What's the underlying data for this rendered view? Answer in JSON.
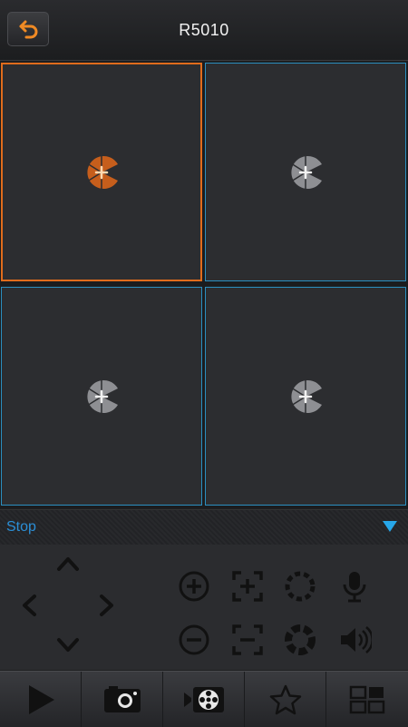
{
  "header": {
    "title": "R5010"
  },
  "status": {
    "text": "Stop"
  },
  "colors": {
    "selected": "#e06c1c",
    "border": "#2b8fc0",
    "accent": "#2b8fd6"
  },
  "icons": {
    "header": [
      "back-arrow-icon"
    ],
    "grid": [
      "add-camera-icon",
      "add-camera-icon",
      "add-camera-icon",
      "add-camera-icon"
    ],
    "ptz": [
      "ptz-up-icon",
      "ptz-left-icon",
      "ptz-right-icon",
      "ptz-down-icon"
    ],
    "controls": [
      "zoom-in-icon",
      "focus-near-icon",
      "iris-open-icon",
      "microphone-icon",
      "zoom-out-icon",
      "focus-far-icon",
      "iris-close-icon",
      "speaker-icon"
    ],
    "toolbar": [
      "play-icon",
      "snapshot-icon",
      "record-icon",
      "favorite-star-icon",
      "layout-icon"
    ]
  }
}
